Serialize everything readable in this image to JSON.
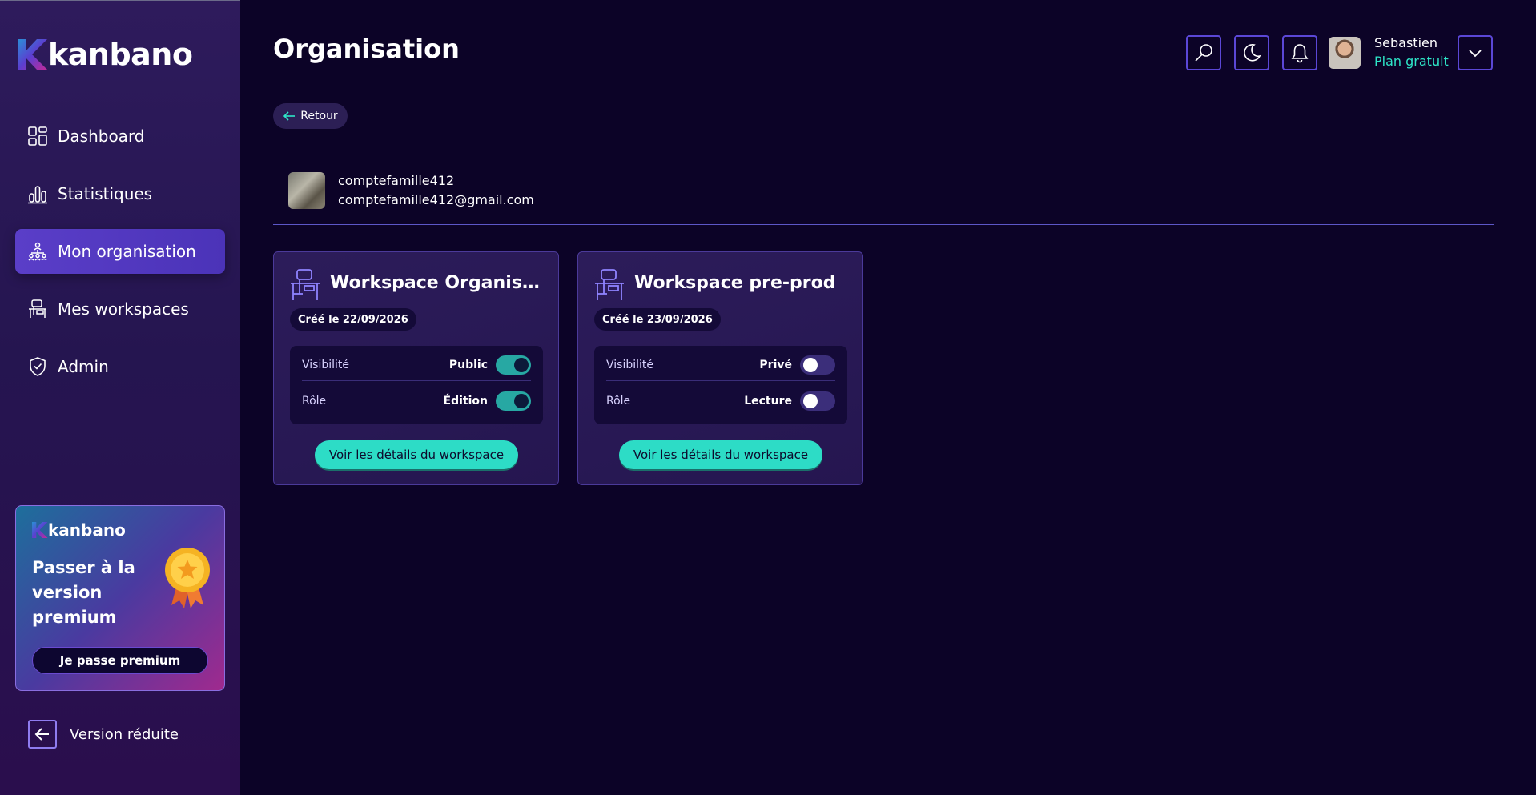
{
  "app": {
    "name": "kanbano"
  },
  "sidebar": {
    "items": [
      {
        "label": "Dashboard",
        "icon": "dashboard-icon"
      },
      {
        "label": "Statistiques",
        "icon": "bar-chart-icon"
      },
      {
        "label": "Mon organisation",
        "icon": "organisation-icon",
        "active": true
      },
      {
        "label": "Mes workspaces",
        "icon": "desk-icon"
      },
      {
        "label": "Admin",
        "icon": "shield-icon"
      }
    ],
    "premium": {
      "logo": "kanbano",
      "title": "Passer à la version premium",
      "button": "Je passe premium",
      "icon": "medal-icon"
    },
    "reduce_label": "Version réduite"
  },
  "header": {
    "title": "Organisation",
    "icons": [
      "search-icon",
      "moon-icon",
      "bell-icon",
      "chevron-down-icon"
    ],
    "user": {
      "name": "Sebastien",
      "plan": "Plan gratuit"
    }
  },
  "main": {
    "back_label": "Retour",
    "organisation": {
      "name": "comptefamille412",
      "email": "comptefamille412@gmail.com"
    },
    "workspaces": [
      {
        "title": "Workspace Organisation",
        "created": "Créé le 22/09/2026",
        "visibility_label": "Visibilité",
        "visibility_value": "Public",
        "visibility_on": true,
        "role_label": "Rôle",
        "role_value": "Édition",
        "role_on": true,
        "button": "Voir les détails du workspace"
      },
      {
        "title": "Workspace pre-prod",
        "created": "Créé le 23/09/2026",
        "visibility_label": "Visibilité",
        "visibility_value": "Privé",
        "visibility_on": false,
        "role_label": "Rôle",
        "role_value": "Lecture",
        "role_on": false,
        "button": "Voir les détails du workspace"
      }
    ]
  },
  "colors": {
    "background": "#0c0327",
    "accent": "#2ddcc6",
    "active_nav": "#5a3ec8",
    "border": "#5b47d6"
  }
}
